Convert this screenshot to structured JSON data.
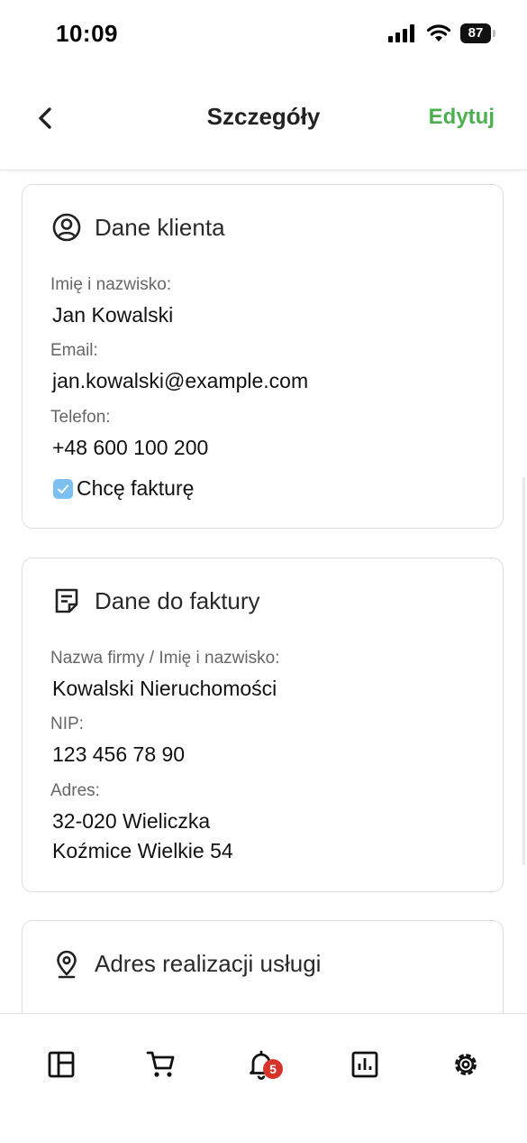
{
  "status_bar": {
    "time": "10:09",
    "battery": "87"
  },
  "header": {
    "title": "Szczegóły",
    "edit_label": "Edytuj"
  },
  "client": {
    "title": "Dane klienta",
    "name_label": "Imię i nazwisko:",
    "name_value": "Jan Kowalski",
    "email_label": "Email:",
    "email_value": "jan.kowalski@example.com",
    "phone_label": "Telefon:",
    "phone_value": "+48 600 100 200",
    "invoice_checkbox_label": "Chcę fakturę",
    "invoice_checked": true
  },
  "invoice": {
    "title": "Dane do faktury",
    "company_label": "Nazwa firmy / Imię i nazwisko:",
    "company_value": "Kowalski Nieruchomości",
    "nip_label": "NIP:",
    "nip_value": "123 456 78 90",
    "address_label": "Adres:",
    "address_line1": "32-020 Wieliczka",
    "address_line2": "Koźmice Wielkie 54"
  },
  "service_address": {
    "title": "Adres realizacji usługi"
  },
  "tab_bar": {
    "items": [
      {
        "icon": "dashboard-icon"
      },
      {
        "icon": "cart-icon"
      },
      {
        "icon": "bell-icon",
        "badge": "5"
      },
      {
        "icon": "stats-icon"
      },
      {
        "icon": "gear-icon"
      }
    ]
  },
  "colors": {
    "accent": "#4caf50",
    "badge": "#d6332a",
    "checkbox": "#7cc0f2"
  }
}
